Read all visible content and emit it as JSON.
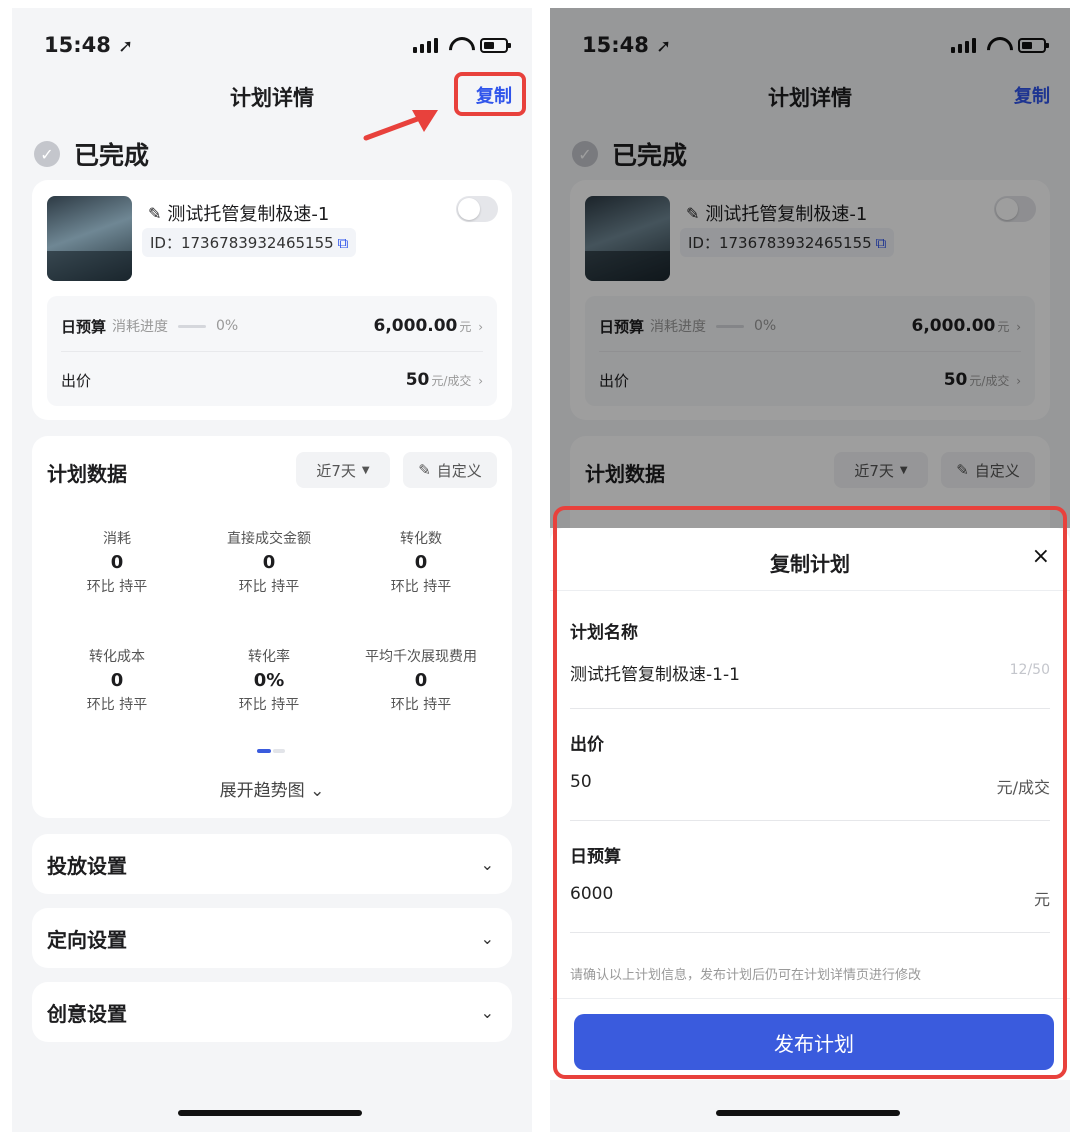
{
  "status_bar": {
    "time": "15:48",
    "location_glyph": "➚"
  },
  "nav": {
    "title": "计划详情",
    "copy_label": "复制"
  },
  "plan": {
    "status": "已完成",
    "name": "测试托管复制极速-1",
    "id": "ID：1736783932465155",
    "daily_budget_label": "日预算",
    "consume_label": "消耗进度",
    "consume_percent": "0%",
    "daily_budget_value": "6,000.00",
    "daily_budget_unit": "元",
    "bid_label": "出价",
    "bid_value": "50",
    "bid_unit": "元/成交"
  },
  "plan_data": {
    "title": "计划数据",
    "range_label": "近7天",
    "custom_label": "自定义",
    "metrics": [
      {
        "label": "消耗",
        "value": "0",
        "compare": "环比 持平"
      },
      {
        "label": "直接成交金额",
        "value": "0",
        "compare": "环比 持平"
      },
      {
        "label": "转化数",
        "value": "0",
        "compare": "环比 持平"
      },
      {
        "label": "转化成本",
        "value": "0",
        "compare": "环比 持平"
      },
      {
        "label": "转化率",
        "value": "0%",
        "compare": "环比 持平"
      },
      {
        "label": "平均千次展现费用",
        "value": "0",
        "compare": "环比 持平"
      }
    ],
    "expand_label": "展开趋势图"
  },
  "sections": [
    {
      "title": "投放设置"
    },
    {
      "title": "定向设置"
    },
    {
      "title": "创意设置"
    }
  ],
  "copy_sheet": {
    "title": "复制计划",
    "name_label": "计划名称",
    "name_value": "测试托管复制极速-1-1",
    "name_count": "12/50",
    "bid_label": "出价",
    "bid_value": "50",
    "bid_unit": "元/成交",
    "budget_label": "日预算",
    "budget_value": "6000",
    "budget_unit": "元",
    "notice": "请确认以上计划信息，发布计划后仍可在计划详情页进行修改",
    "publish_label": "发布计划"
  },
  "colors": {
    "accent": "#2f54eb",
    "publish_button": "#3a5bdd",
    "highlight_red": "#e8413c",
    "page_bg": "#f4f5f7"
  },
  "icons": {
    "close": "×",
    "chevron_down": "⌄",
    "caret_down": "▼",
    "pencil": "✎",
    "check": "✓",
    "copy": "⧉",
    "chevron_right": "›"
  }
}
